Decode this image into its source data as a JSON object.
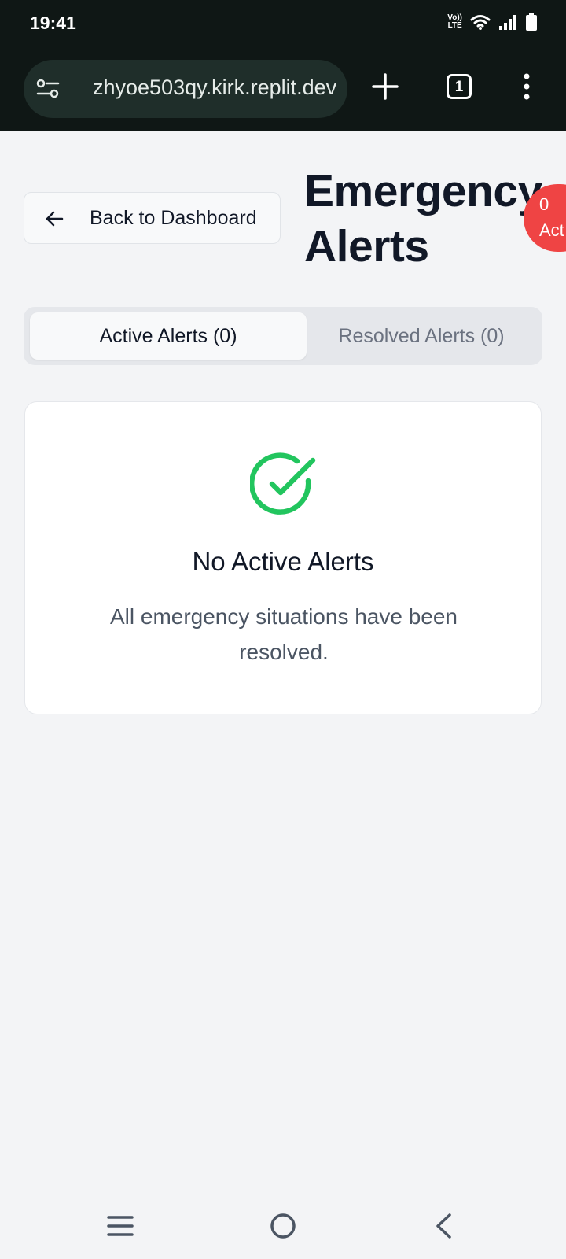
{
  "status_bar": {
    "time": "19:41",
    "network_label_top": "Vo))",
    "network_label_bottom": "LTE",
    "icons": [
      "volte-icon",
      "wifi-icon",
      "signal-icon",
      "battery-icon"
    ]
  },
  "browser": {
    "url": "zhyoe503qy.kirk.replit.dev",
    "tab_count": "1",
    "icons": [
      "site-settings-icon",
      "new-tab-icon",
      "tabs-icon",
      "more-menu-icon"
    ]
  },
  "page": {
    "back_label": "Back to Dashboard",
    "title_line1": "Emergency",
    "title_line2": "Alerts",
    "badge_count": "0",
    "badge_label": "Act"
  },
  "tabs": [
    {
      "label": "Active Alerts (0)",
      "selected": true
    },
    {
      "label": "Resolved Alerts (0)",
      "selected": false
    }
  ],
  "empty_state": {
    "icon": "check-circle-icon",
    "title": "No Active Alerts",
    "description": "All emergency situations have been resolved."
  },
  "colors": {
    "badge": "#ef4444",
    "success": "#22c55e",
    "page_bg": "#f3f4f6",
    "chrome_bg": "#0f1715"
  }
}
